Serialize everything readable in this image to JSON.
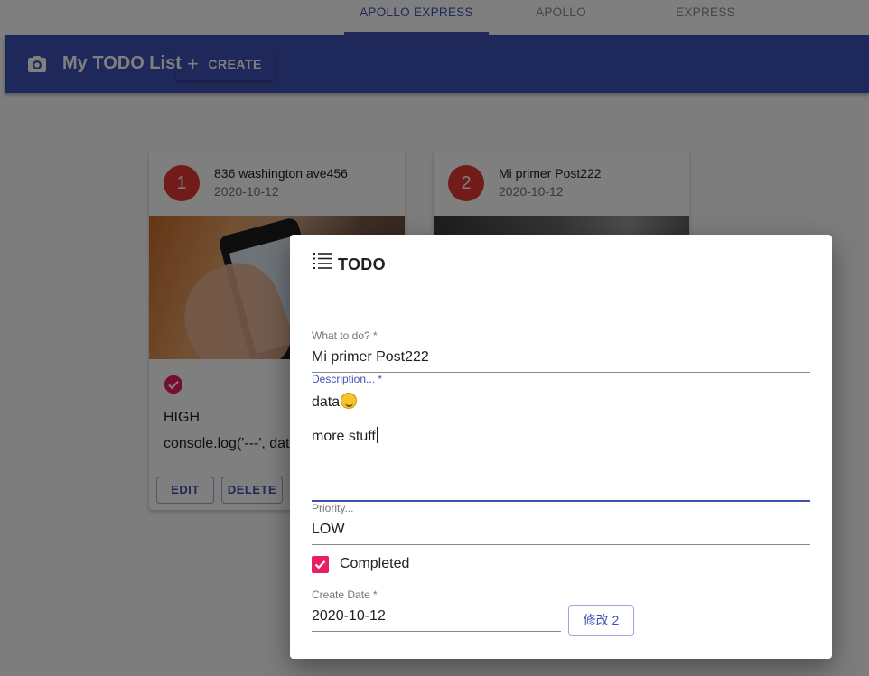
{
  "tabs": [
    {
      "label": "APOLLO EXPRESS",
      "active": true
    },
    {
      "label": "APOLLO",
      "active": false
    },
    {
      "label": "EXPRESS",
      "active": false
    }
  ],
  "appbar": {
    "title": "My TODO List",
    "create_label": "CREATE",
    "icon": "camera-icon",
    "color": "#3f51b5"
  },
  "cards": [
    {
      "avatar": "1",
      "title": "836 washington ave456",
      "date": "2020-10-12",
      "completed": true,
      "priority": "HIGH",
      "description": "console.log('---', data",
      "edit_label": "EDIT",
      "delete_label": "DELETE"
    },
    {
      "avatar": "2",
      "title": "Mi primer Post222",
      "date": "2020-10-12"
    }
  ],
  "dialog": {
    "title": "TODO",
    "icon": "list-icon",
    "what_label": "What to do? *",
    "what_value": "Mi primer Post222",
    "description_label": "Description... *",
    "description_line1": "data",
    "description_emoji": "rolling-on-floor-laughing-emoji",
    "description_line2": "more stuff",
    "priority_label": "Priority...",
    "priority_value": "LOW",
    "completed_label": "Completed",
    "completed": true,
    "create_date_label": "Create Date *",
    "create_date_value": "2020-10-12",
    "submit_label": "修改 2"
  },
  "colors": {
    "primary": "#3f51b5",
    "avatar": "#e53935",
    "checkbox": "#e91e63"
  }
}
